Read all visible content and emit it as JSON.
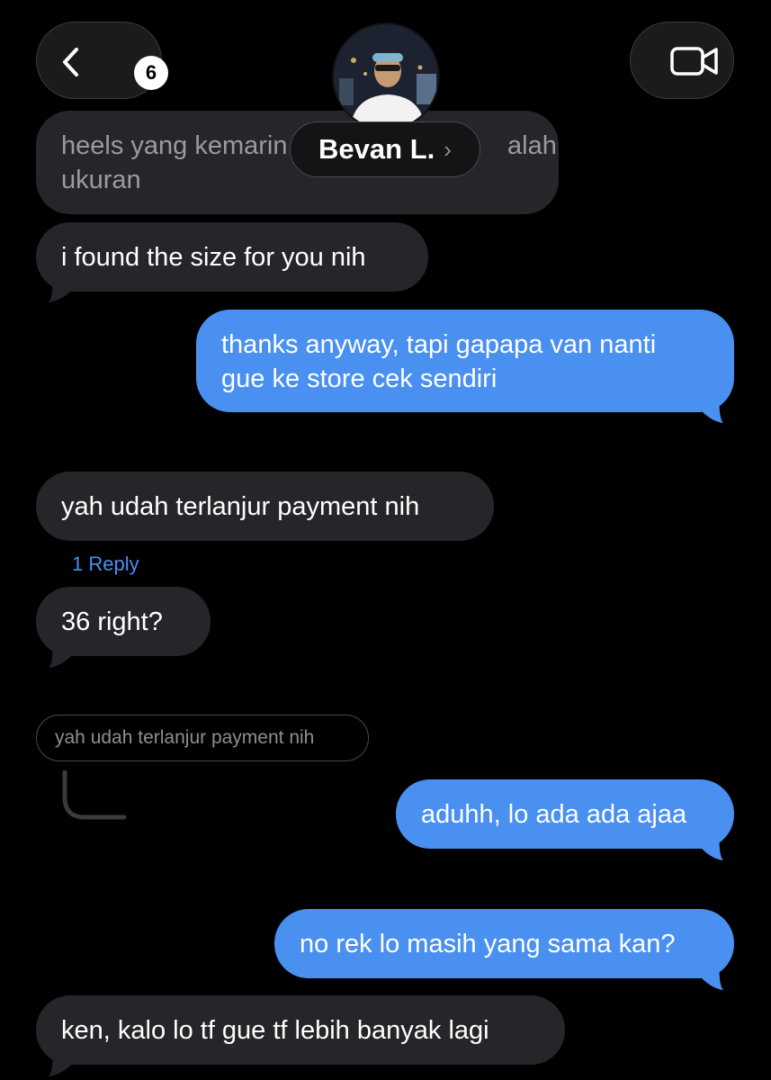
{
  "header": {
    "unread_count": "6",
    "contact_name": "Bevan L.",
    "back_icon": "chevron-left-icon",
    "video_icon": "video-camera-icon",
    "name_chevron": "›"
  },
  "messages": [
    {
      "id": "m1",
      "side": "received",
      "text_lines": [
        "heels yang kemarin",
        "ukuran"
      ],
      "text_tail_line1": "alah",
      "obscured": true
    },
    {
      "id": "m2",
      "side": "received",
      "text_lines": [
        "i found the size for you nih"
      ]
    },
    {
      "id": "m3",
      "side": "sent",
      "text_lines": [
        "thanks anyway, tapi gapapa van nanti",
        "gue ke store cek sendiri"
      ]
    },
    {
      "id": "m4",
      "side": "received",
      "text_lines": [
        "yah udah terlanjur payment nih"
      ]
    },
    {
      "id": "m5",
      "side": "received",
      "text_lines": [
        "36 right?"
      ]
    },
    {
      "id": "m6",
      "side": "sent",
      "text_lines": [
        "aduhh, lo ada ada ajaa"
      ]
    },
    {
      "id": "m7",
      "side": "sent",
      "text_lines": [
        "no rek lo masih yang sama kan?"
      ]
    },
    {
      "id": "m8",
      "side": "received",
      "text_lines": [
        "ken, kalo lo tf gue tf lebih banyak lagi"
      ]
    }
  ],
  "thread": {
    "reply_count_label": "1 Reply",
    "quoted_text": "yah udah terlanjur payment nih"
  },
  "colors": {
    "background": "#000000",
    "received_bubble": "#26252a",
    "sent_bubble": "#4a90f0",
    "link": "#4a8ff0"
  }
}
